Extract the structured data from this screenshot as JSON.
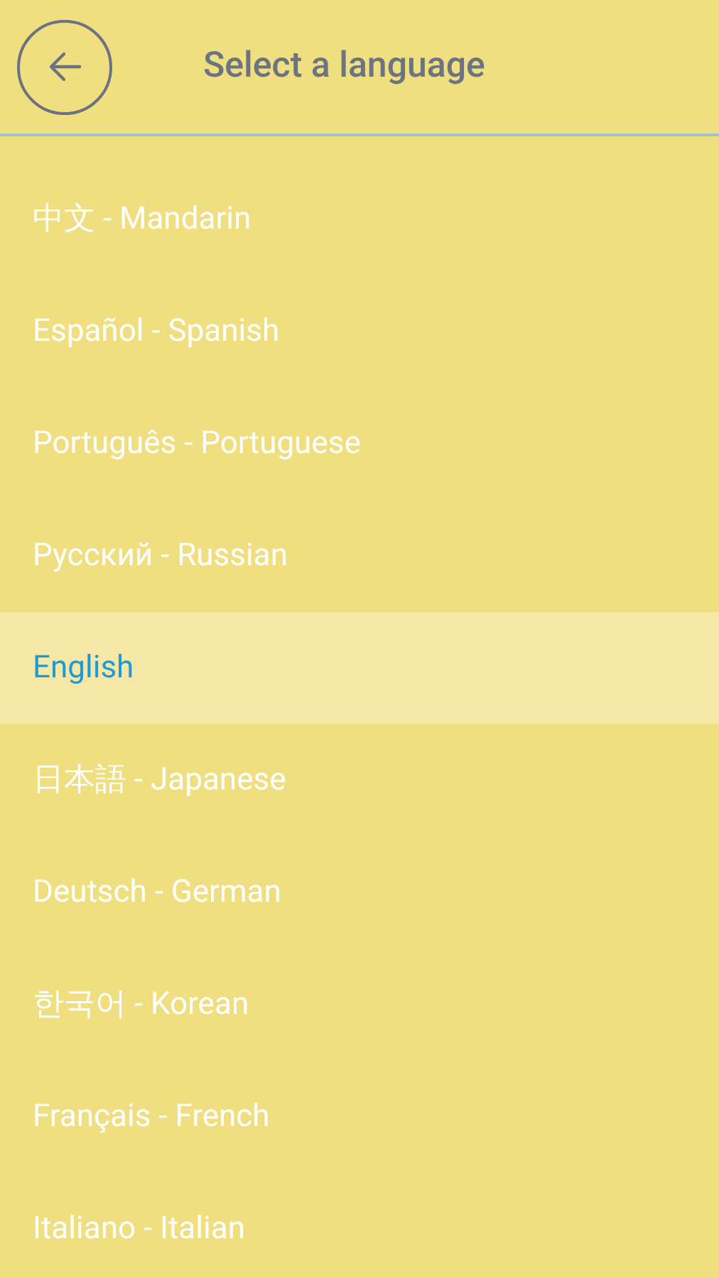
{
  "header": {
    "title": "Select a language"
  },
  "languages": [
    {
      "label": "中文 - Mandarin",
      "selected": false
    },
    {
      "label": "Español - Spanish",
      "selected": false
    },
    {
      "label": "Português - Portuguese",
      "selected": false
    },
    {
      "label": "Русский - Russian",
      "selected": false
    },
    {
      "label": "English",
      "selected": true
    },
    {
      "label": "日本語 - Japanese",
      "selected": false
    },
    {
      "label": "Deutsch - German",
      "selected": false
    },
    {
      "label": "한국어 - Korean",
      "selected": false
    },
    {
      "label": "Français - French",
      "selected": false
    },
    {
      "label": "Italiano - Italian",
      "selected": false
    }
  ]
}
